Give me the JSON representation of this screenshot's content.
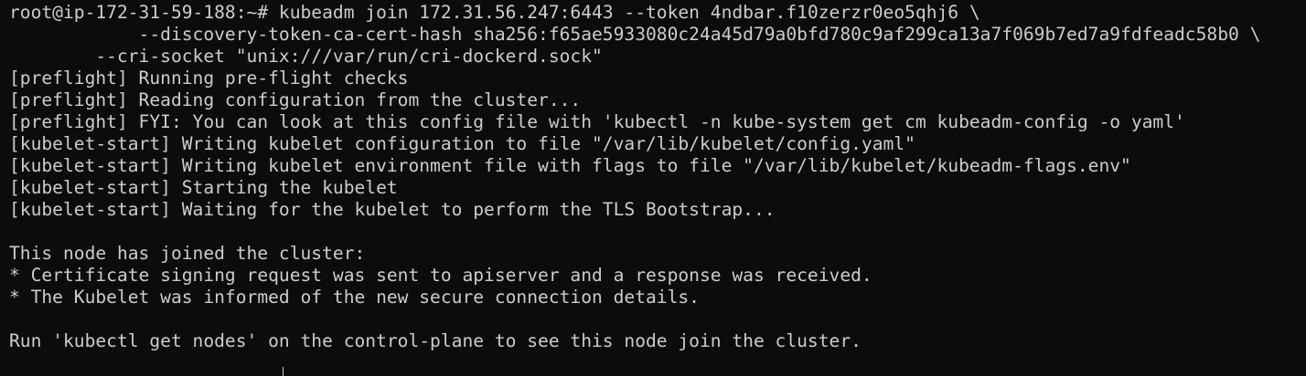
{
  "terminal": {
    "command": {
      "prompt": "root@ip-172-31-59-188:~#",
      "line1": " kubeadm join 172.31.56.247:6443 --token 4ndbar.f10zerzr0eo5qhj6 \\",
      "line2": "            --discovery-token-ca-cert-hash sha256:f65ae5933080c24a45d79a0bfd780c9af299ca13a7f069b7ed7a9fdfeadc58b0 \\",
      "line3": "        --cri-socket \"unix:///var/run/cri-dockerd.sock\""
    },
    "output": [
      "[preflight] Running pre-flight checks",
      "[preflight] Reading configuration from the cluster...",
      "[preflight] FYI: You can look at this config file with 'kubectl -n kube-system get cm kubeadm-config -o yaml'",
      "[kubelet-start] Writing kubelet configuration to file \"/var/lib/kubelet/config.yaml\"",
      "[kubelet-start] Writing kubelet environment file with flags to file \"/var/lib/kubelet/kubeadm-flags.env\"",
      "[kubelet-start] Starting the kubelet",
      "[kubelet-start] Waiting for the kubelet to perform the TLS Bootstrap...",
      "",
      "This node has joined the cluster:",
      "* Certificate signing request was sent to apiserver and a response was received.",
      "* The Kubelet was informed of the new secure connection details.",
      "",
      "Run 'kubectl get nodes' on the control-plane to see this node join the cluster."
    ]
  },
  "colors": {
    "background": "#0c0c0c",
    "foreground": "#cccccc"
  }
}
